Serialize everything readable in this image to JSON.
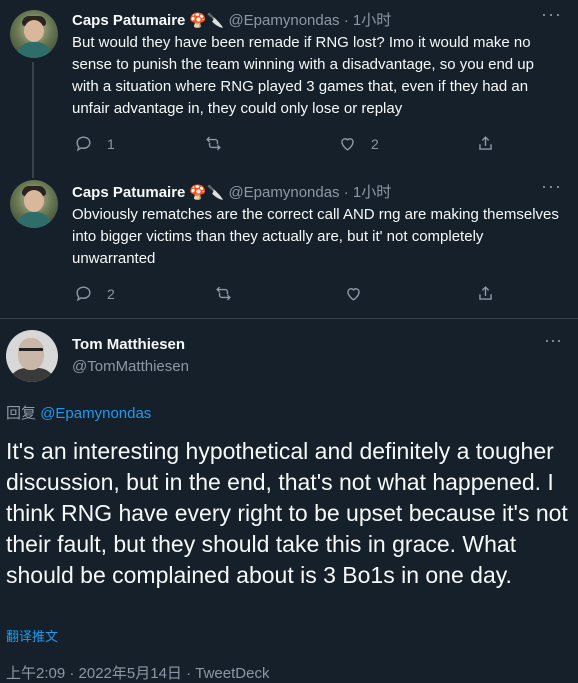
{
  "tweets": [
    {
      "name": "Caps Patumaire",
      "emoji": "🍄🔪",
      "handle": "@Epamynondas",
      "dot": "·",
      "time": "1小时",
      "text": "But would they have been remade if RNG lost? Imo it would make no sense to punish the team winning with a disadvantage, so you end up with a situation where RNG played 3 games that, even if they had an unfair advantage in, they could only lose or replay",
      "reply_count": "1",
      "retweet_count": "",
      "like_count": "2"
    },
    {
      "name": "Caps Patumaire",
      "emoji": "🍄🔪",
      "handle": "@Epamynondas",
      "dot": "·",
      "time": "1小时",
      "text": "Obviously rematches are the correct call AND rng are making themselves into bigger victims than they actually are, but it' not completely unwarranted",
      "reply_count": "2",
      "retweet_count": "",
      "like_count": ""
    }
  ],
  "main": {
    "name": "Tom Matthiesen",
    "handle": "@TomMatthiesen",
    "replying_prefix": "回复",
    "replying_to": "@Epamynondas",
    "text": "It's an interesting hypothetical and definitely a tougher discussion, but in the end, that's not what happened. I think RNG have every right to be upset because it's not their fault, but they should take this in grace. What should be complained about is 3 Bo1s in one day.",
    "translate": "翻译推文",
    "meta": "上午2:09 · 2022年5月14日 · TweetDeck"
  },
  "more_label": "···",
  "icons": [
    "reply-icon",
    "retweet-icon",
    "like-icon",
    "share-icon",
    "more-icon"
  ],
  "colors": {
    "background": "#15202b",
    "link": "#1d9bf0",
    "muted": "#8b98a5"
  }
}
